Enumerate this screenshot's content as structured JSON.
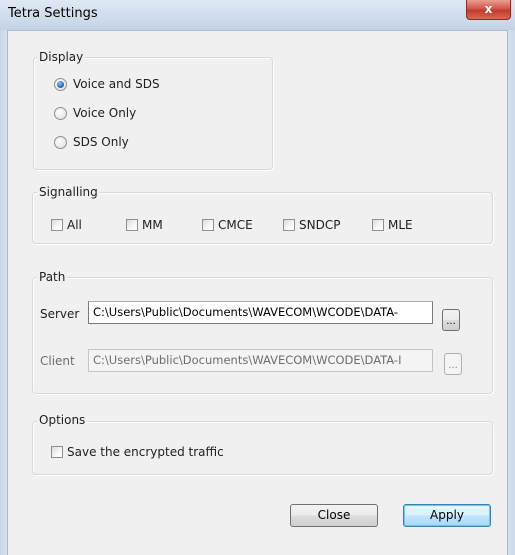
{
  "window": {
    "title": "Tetra Settings",
    "close_glyph": "x"
  },
  "display": {
    "legend": "Display",
    "options": [
      {
        "label": "Voice and SDS",
        "checked": true
      },
      {
        "label": "Voice Only",
        "checked": false
      },
      {
        "label": "SDS Only",
        "checked": false
      }
    ]
  },
  "signalling": {
    "legend": "Signalling",
    "options": [
      {
        "label": "All",
        "checked": false
      },
      {
        "label": "MM",
        "checked": false
      },
      {
        "label": "CMCE",
        "checked": false
      },
      {
        "label": "SNDCP",
        "checked": false
      },
      {
        "label": "MLE",
        "checked": false
      }
    ]
  },
  "path": {
    "legend": "Path",
    "server_label": "Server",
    "server_value": "C:\\Users\\Public\\Documents\\WAVECOM\\WCODE\\DATA-",
    "client_label": "Client",
    "client_value": "C:\\Users\\Public\\Documents\\WAVECOM\\WCODE\\DATA-I",
    "browse_label": "..."
  },
  "options": {
    "legend": "Options",
    "save_encrypted_label": "Save the encrypted traffic",
    "save_encrypted_checked": false
  },
  "buttons": {
    "close": "Close",
    "apply": "Apply"
  }
}
